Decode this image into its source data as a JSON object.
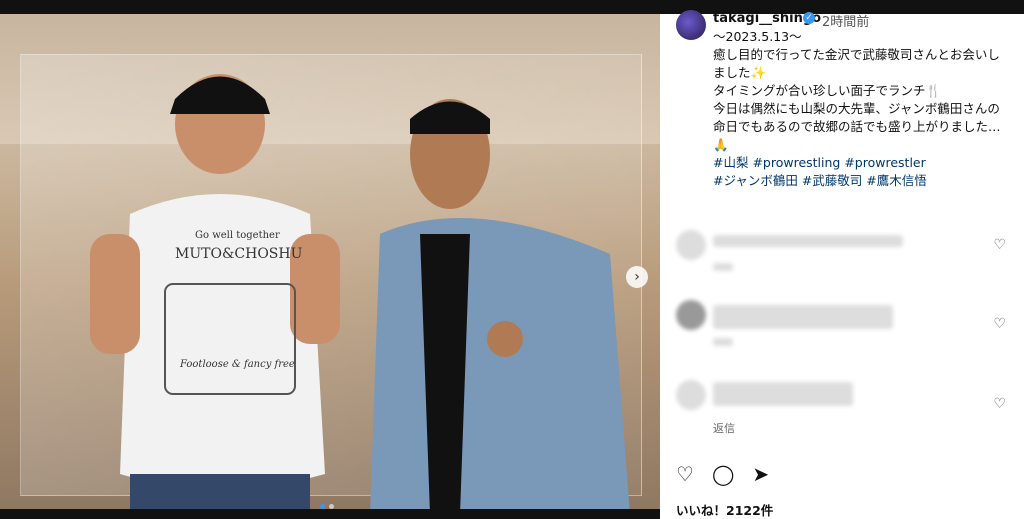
{
  "post": {
    "username": "takagi__shingo",
    "time": "2時間前",
    "caption_lines": [
      "〜2023.5.13〜",
      "癒し目的で行ってた金沢で武藤敬司さんとお会いし",
      "ました✨",
      "タイミングが合い珍しい面子でランチ🍴",
      "今日は偶然にも山梨の大先輩、ジャンボ鶴田さんの",
      "命日でもあるので故郷の話でも盛り上がりました…",
      "🙏"
    ],
    "tags_line1": "#山梨 #prowrestling #prowrestler",
    "tags_line2": "#ジャンボ鶴田 #武藤敬司 #鷹木信悟",
    "reply_label": "返信",
    "likes": "いいね！2122件"
  },
  "photo": {
    "shirt_text_top": "Go well together",
    "shirt_text_main": "MUTO&CHOSHU",
    "shirt_text_bottom": "Footloose & fancy free"
  },
  "icons": {
    "next": "chevron-right-icon",
    "like": "heart-icon",
    "comment": "comment-icon",
    "share": "send-icon"
  },
  "colors": {
    "verified": "#3897f0",
    "hashtag": "#00376b"
  }
}
